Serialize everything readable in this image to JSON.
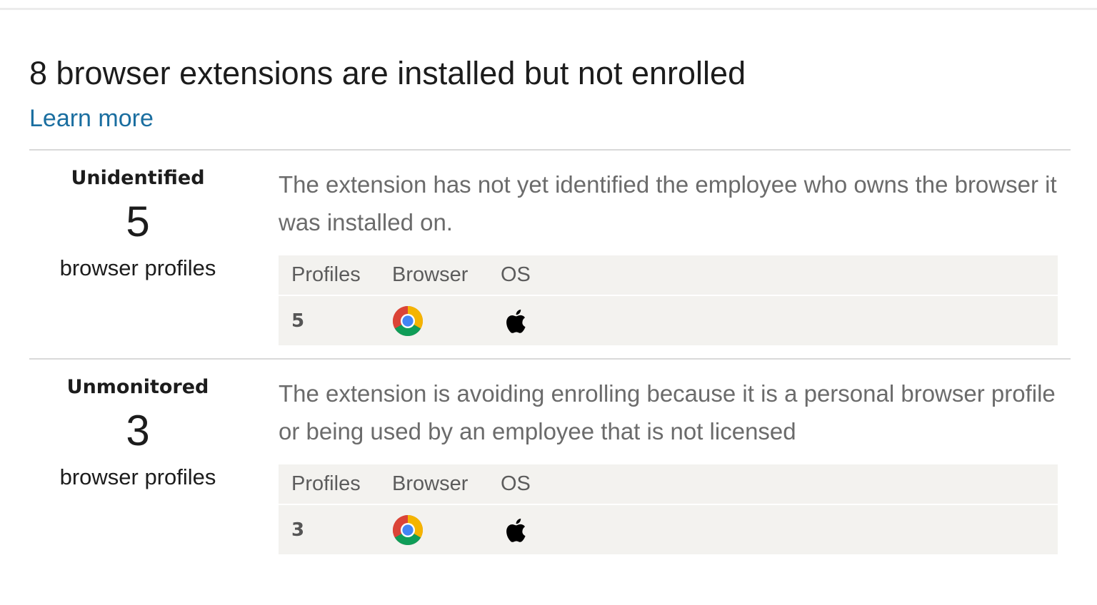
{
  "header": {
    "title": "8 browser extensions are installed but not enrolled",
    "learn_more": "Learn more"
  },
  "sections": [
    {
      "label": "Unidentified",
      "count": "5",
      "unit": "browser profiles",
      "description": "The extension has not yet identified the employee who owns the browser it was installed on.",
      "table": {
        "headers": [
          "Profiles",
          "Browser",
          "OS"
        ],
        "rows": [
          {
            "profiles": "5",
            "browser_icon": "chrome-icon",
            "os_icon": "apple-icon"
          }
        ]
      }
    },
    {
      "label": "Unmonitored",
      "count": "3",
      "unit": "browser profiles",
      "description": "The extension is avoiding enrolling because it is a personal browser profile or being used by an employee that is not licensed",
      "table": {
        "headers": [
          "Profiles",
          "Browser",
          "OS"
        ],
        "rows": [
          {
            "profiles": "3",
            "browser_icon": "chrome-icon",
            "os_icon": "apple-icon"
          }
        ]
      }
    }
  ],
  "colors": {
    "link": "#1a6ea0",
    "table_background": "#f3f2ef",
    "description_text": "#6b6b6b"
  }
}
